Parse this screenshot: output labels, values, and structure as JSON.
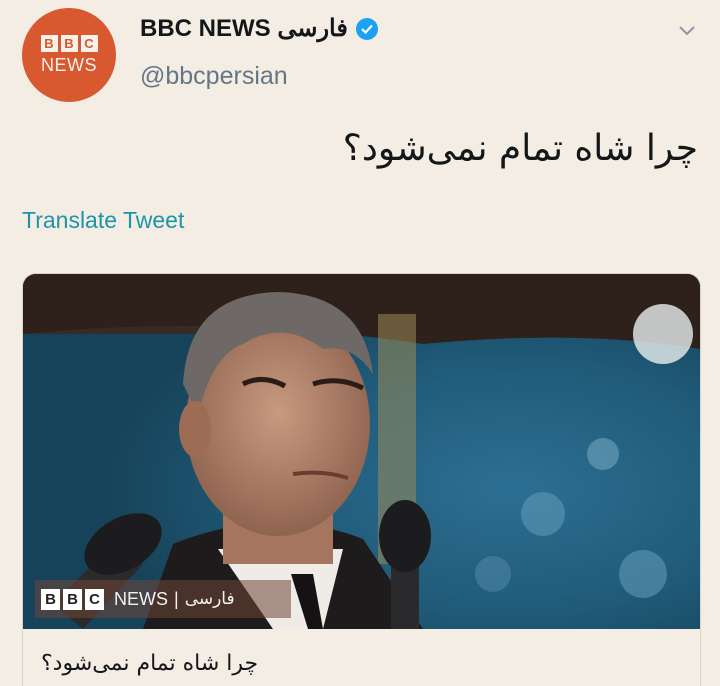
{
  "tweet": {
    "avatar": {
      "letters": [
        "B",
        "B",
        "C"
      ],
      "word": "NEWS"
    },
    "display_name": "BBC NEWS فارسی",
    "verified_icon": "verified-badge-icon",
    "handle": "@bbcpersian",
    "menu_icon": "chevron-down-icon",
    "text": "چرا شاه تمام نمی‌شود؟",
    "translate_label": "Translate Tweet"
  },
  "card": {
    "image_badge": {
      "letters": [
        "B",
        "B",
        "C"
      ],
      "news": "NEWS",
      "separator": "|",
      "language": "فارسی"
    },
    "title": "چرا شاه تمام نمی‌شود؟"
  },
  "colors": {
    "brand": "#d8582f",
    "verified": "#1da1f2",
    "link": "#1b95a8",
    "background": "#f4ede4"
  }
}
